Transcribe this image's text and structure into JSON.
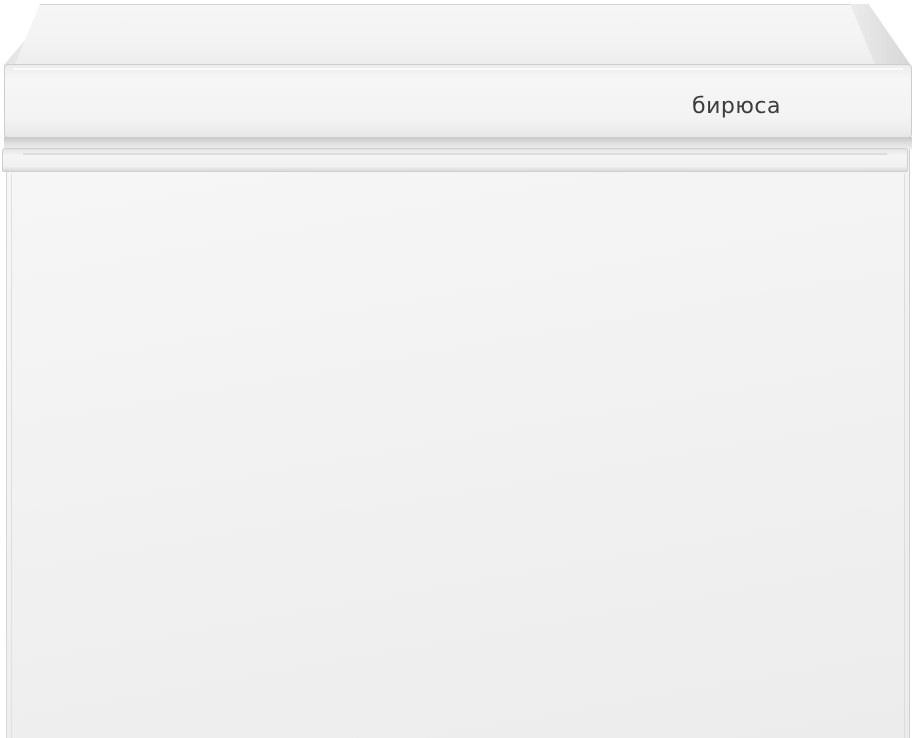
{
  "product": {
    "brand_logo": "бирюса"
  }
}
